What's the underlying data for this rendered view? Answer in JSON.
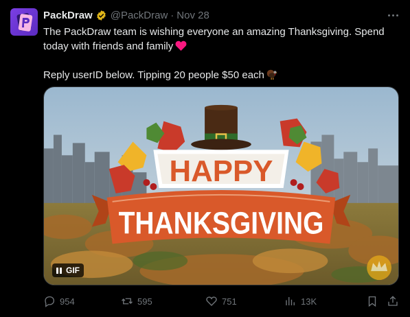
{
  "tweet": {
    "display_name": "PackDraw",
    "handle": "@PackDraw",
    "separator": "·",
    "date": "Nov 28",
    "text_line_1": "The PackDraw team is wishing everyone an amazing Thanksgiving. Spend",
    "text_line_2": "today with friends and family",
    "text_line_3": "Reply userID below. Tipping 20 people $50 each",
    "emoji_1": "red-heart",
    "emoji_2": "turkey"
  },
  "media": {
    "banner_word_1": "HAPPY",
    "banner_word_2": "THANKSGIVING",
    "gif_label": "GIF"
  },
  "actions": {
    "replies": "954",
    "reposts": "595",
    "likes": "751",
    "views": "13K"
  },
  "icons": {
    "verified": "verified-badge-gold",
    "more": "more-horizontal-icon",
    "reply": "reply-icon",
    "repost": "repost-icon",
    "like": "like-icon",
    "views": "views-icon",
    "bookmark": "bookmark-icon",
    "share": "share-icon"
  },
  "colors": {
    "background": "#000000",
    "text": "#e7e9ea",
    "muted": "#71767b",
    "verified_gold": "#e2b719",
    "banner_orange": "#d9592a"
  }
}
